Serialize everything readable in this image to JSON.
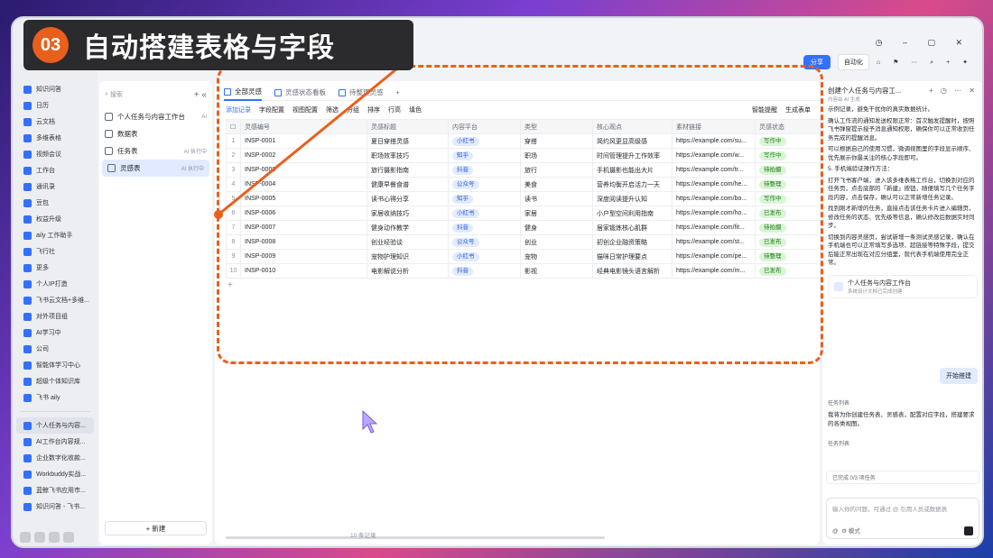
{
  "banner": {
    "number": "03",
    "title": "自动搭建表格与字段"
  },
  "sidebar": {
    "items": [
      "知识问答",
      "日历",
      "云文档",
      "多维表格",
      "视频会议",
      "工作台",
      "通讯录",
      "豆包",
      "权益升级",
      "aily 工作助手",
      "飞行社",
      "更多",
      "个人IP打造",
      "飞书云文档+多维...",
      "对外项目组",
      "AI学习中",
      "公司",
      "智能体学习中心",
      "超级个体知识库",
      "飞书 aily"
    ],
    "recent": [
      "个人任务与内容...",
      "AI工作台内容规...",
      "企业数字化收款...",
      "Workbuddy实战...",
      "蓝鲸飞书应用市...",
      "知识问答 - 飞书..."
    ]
  },
  "panel2": {
    "search": "搜索",
    "items": [
      {
        "label": "个人任务与内容工作台",
        "tag": "AI"
      },
      {
        "label": "数据表",
        "tag": ""
      },
      {
        "label": "任务表",
        "tag": "AI 执行中"
      },
      {
        "label": "灵感表",
        "tag": "AI 执行中"
      }
    ],
    "new_button": "+ 新建"
  },
  "main": {
    "tabs": [
      "全部灵感",
      "灵感状态看板",
      "待整理灵感"
    ],
    "toolbar": {
      "add": "添加记录",
      "field": "字段配置",
      "view": "视图配置",
      "filter": "筛选",
      "group": "分组",
      "sort": "排序",
      "row": "行高",
      "fill": "填色"
    },
    "toolbar_right": {
      "remind": "智能提醒",
      "form": "生成表单"
    },
    "columns": [
      "灵感编号",
      "灵感标题",
      "内容平台",
      "类型",
      "核心观点",
      "素材链接",
      "灵感状态"
    ],
    "rows": [
      [
        "INSP-0001",
        "夏日穿搭灵感",
        "小红书",
        "穿搭",
        "简约风更显高级感",
        "https://example.com/su...",
        "写作中"
      ],
      [
        "INSP-0002",
        "职场效率技巧",
        "知乎",
        "职场",
        "时间管理提升工作效率",
        "https://example.com/w...",
        "写作中"
      ],
      [
        "INSP-0003",
        "旅行摄影指南",
        "抖音",
        "旅行",
        "手机摄影也能出大片",
        "https://example.com/tr...",
        "待拍摄"
      ],
      [
        "INSP-0004",
        "健康早餐食谱",
        "公众号",
        "美食",
        "营养均衡开启活力一天",
        "https://example.com/he...",
        "待整理"
      ],
      [
        "INSP-0005",
        "读书心得分享",
        "知乎",
        "读书",
        "深度阅读提升认知",
        "https://example.com/bo...",
        "写作中"
      ],
      [
        "INSP-0006",
        "家居收纳技巧",
        "小红书",
        "家居",
        "小户型空间利用指南",
        "https://example.com/ho...",
        "已发布"
      ],
      [
        "INSP-0007",
        "健身动作教学",
        "抖音",
        "健身",
        "居家锻炼核心肌群",
        "https://example.com/fit...",
        "待拍摄"
      ],
      [
        "INSP-0008",
        "创业经验谈",
        "公众号",
        "创业",
        "初创企业融资策略",
        "https://example.com/st...",
        "已发布"
      ],
      [
        "INSP-0009",
        "宠物护理知识",
        "小红书",
        "宠物",
        "猫咪日常护理要点",
        "https://example.com/pe...",
        "待整理"
      ],
      [
        "INSP-0010",
        "电影解说分析",
        "抖音",
        "影视",
        "经典电影镜头语言解析",
        "https://example.com/m...",
        "已发布"
      ]
    ],
    "record_count": "10 条记录"
  },
  "right_panel": {
    "title": "创建个人任务与内容工...",
    "subtitle": "内容由 AI 生成",
    "text1": "示例记录，避免干扰你的真实数据统计。",
    "bullets": [
      "确认工作流的通知发送权限正常：首次触发提醒时，按照飞书弹窗提示授予消息通知权限，确保你可以正常收到任务完成的提醒消息。",
      "可以根据自己的使用习惯，微调视图里的字段显示顺序、优先展示你最关注的核心字段即可。"
    ],
    "step5": "5. 手机端验证操作方法：",
    "bullets2": [
      "打开飞书客户端，进入该多维表格工作台，切换到对应的任务页，点击底部的「新建」按钮，随便填写几个任务字段内容，点击保存，确认可以正常新增任务记录。",
      "找到刚才新增的任务，直接点击该任务卡片进入编辑页，修改任务的状态、优先级等信息，确认修改后数据实时同步。",
      "切换到内容灵感页，尝试新增一条测试灵感记录，确认在手机端也可以正常填写多选项、超链接等特殊字段，提交后能正常出现在对应分组里，就代表手机端使用完全正常。"
    ],
    "card": {
      "title": "个人任务与内容工作台",
      "sub": "系统设计文档已完成创建"
    },
    "start_button": "开始搭建",
    "task_list": "任务列表",
    "reply": "我将为你创建任务表、灵感表，配置对应字段，搭建要求的各类视图。",
    "progress": "已完成 0/3 项任务",
    "input_placeholder": "输入你的问题，可通过 @ 引用人员或数据表",
    "mode": "模式"
  },
  "topbar": {
    "share": "分享",
    "automation": "自动化"
  }
}
